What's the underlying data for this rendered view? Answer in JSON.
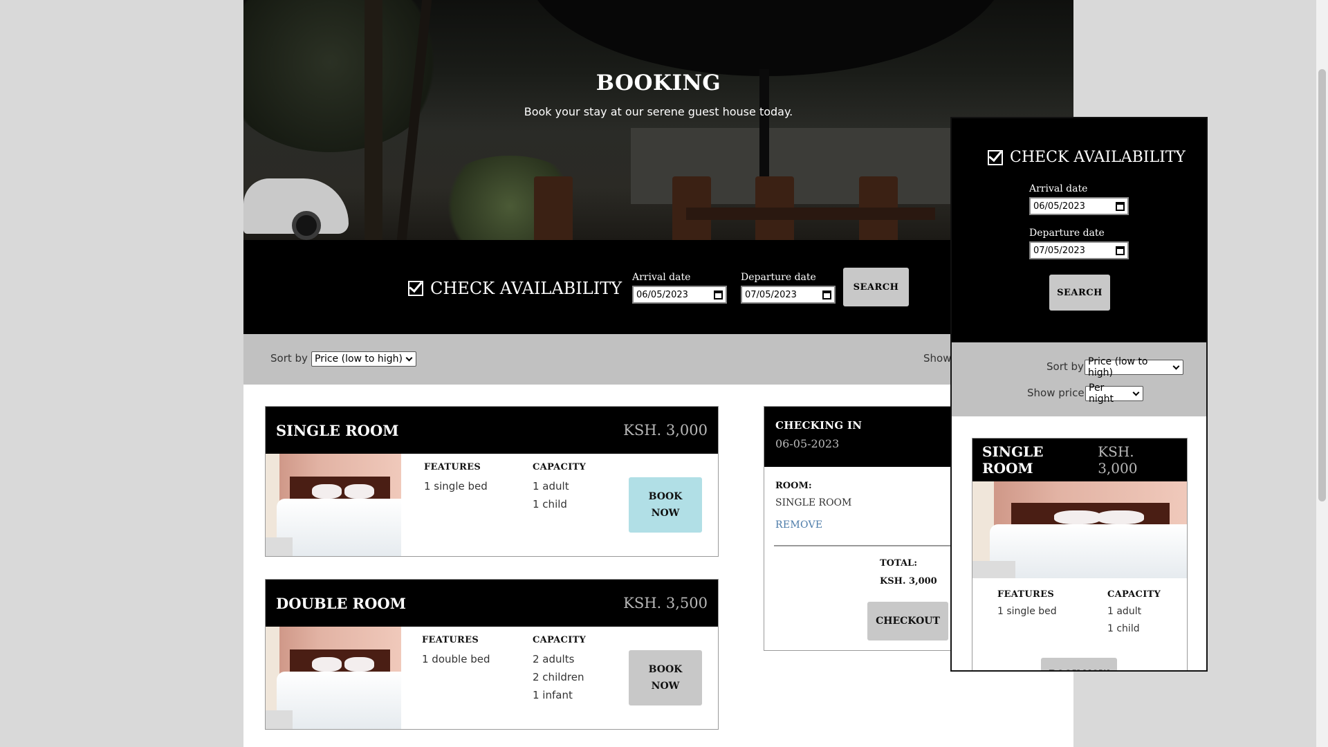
{
  "hero": {
    "title": "BOOKING",
    "subtitle": "Book your stay at our serene guest house today."
  },
  "availability": {
    "title": "CHECK AVAILABILITY",
    "arrival_label": "Arrival date",
    "arrival_value": "06/05/2023",
    "departure_label": "Departure date",
    "departure_value": "07/05/2023",
    "search_label": "SEARCH"
  },
  "sort": {
    "label": "Sort by",
    "selected": "Price (low to high)",
    "show_label_partial": "Show",
    "show_price_label": "Show price",
    "show_price_selected": "Per night"
  },
  "rooms": [
    {
      "name": "SINGLE ROOM",
      "price": "KSH. 3,000",
      "features_label": "FEATURES",
      "features": [
        "1 single bed"
      ],
      "capacity_label": "CAPACITY",
      "capacity": [
        "1 adult",
        "1 child"
      ],
      "book_label": "BOOK NOW",
      "book_color": "#b1dfe6"
    },
    {
      "name": "DOUBLE ROOM",
      "price": "KSH. 3,500",
      "features_label": "FEATURES",
      "features": [
        "1 double bed"
      ],
      "capacity_label": "CAPACITY",
      "capacity": [
        "2 adults",
        "2 children",
        "1 infant"
      ],
      "book_label": "BOOK NOW",
      "book_color": "#c8c8c8"
    }
  ],
  "checkout": {
    "checking_in_label": "CHECKING IN",
    "checking_in_date": "06-05-2023",
    "room_label": "ROOM:",
    "room_value": "SINGLE ROOM",
    "remove_label": "REMOVE",
    "total_label": "TOTAL:",
    "total_value": "KSH. 3,000",
    "checkout_label": "CHECKOUT"
  },
  "preview": {
    "book_label_partial": "BOOK NOW"
  },
  "icons": {
    "checkbox": "check-square-icon",
    "calendar": "calendar-icon",
    "chevron": "chevron-down-icon"
  }
}
